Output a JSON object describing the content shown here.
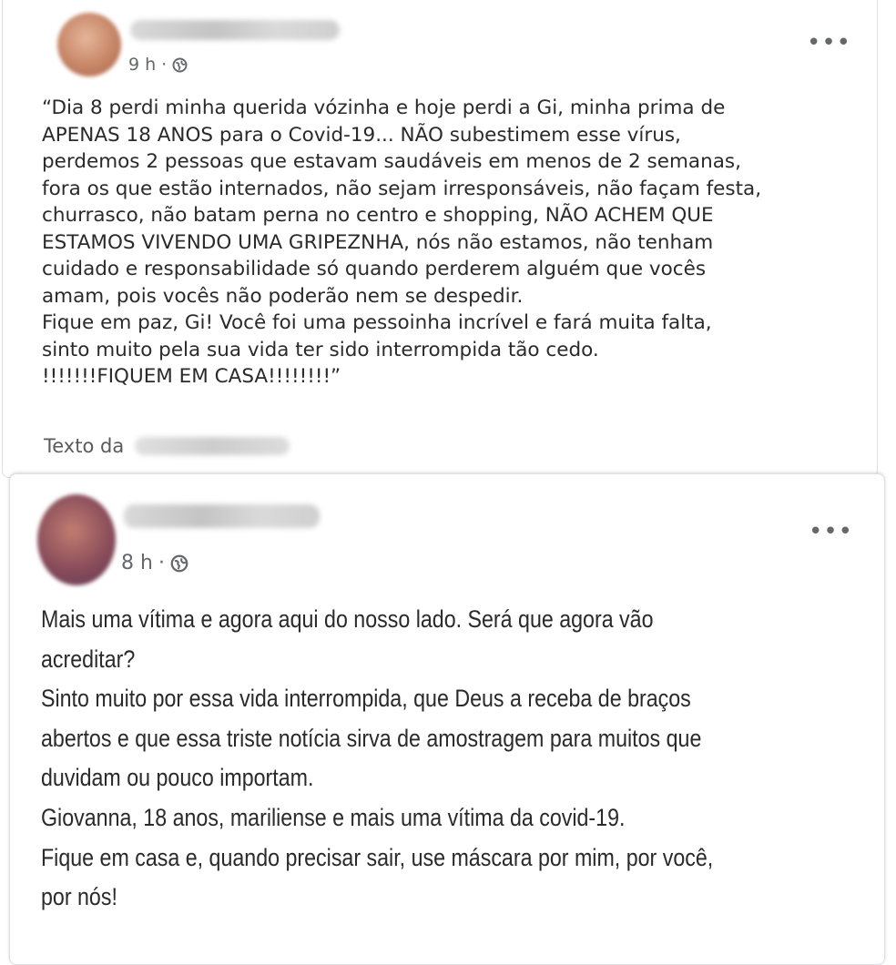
{
  "post1": {
    "time": "9 h",
    "separator": "·",
    "more_label": "•••",
    "lines": [
      "“Dia 8 perdi minha querida vózinha e hoje perdi a Gi, minha prima de",
      "APENAS 18 ANOS para o Covid-19... NÃO subestimem esse vírus,",
      "perdemos 2 pessoas que estavam saudáveis em menos de 2 semanas,",
      "fora os que estão internados, não sejam irresponsáveis, não façam festa,",
      "churrasco, não batam perna no centro e shopping, NÃO ACHEM QUE",
      "ESTAMOS VIVENDO UMA GRIPEZNHA, nós não estamos, não tenham",
      "cuidado e responsabilidade só quando perderem alguém que vocês",
      "amam, pois vocês não poderão nem se despedir.",
      "Fique em paz, Gi! Você foi uma pessoinha incrível e fará muita falta,",
      "sinto muito pela sua vida ter sido interrompida tão cedo.",
      "!!!!!!!FIQUEM EM CASA!!!!!!!!”"
    ],
    "credit_prefix": "Texto da"
  },
  "post2": {
    "time": "8 h",
    "separator": "·",
    "more_label": "•••",
    "lines": [
      "Mais uma vítima e agora aqui do nosso lado. Será que agora vão",
      "acreditar?",
      "Sinto muito por essa vida interrompida, que Deus a receba de braços",
      "abertos e que essa triste notícia sirva de amostragem para muitos que",
      "duvidam ou pouco importam.",
      "Giovanna, 18 anos, mariliense e mais uma vítima da covid-19.",
      "Fique em casa e, quando precisar sair, use máscara por mim, por você,",
      "por nós!"
    ]
  },
  "icons": {
    "privacy": "globe-icon",
    "menu": "more-options-icon"
  },
  "colors": {
    "meta": "#65676b",
    "text": "#2a2a2a",
    "border": "#dddfe2"
  }
}
